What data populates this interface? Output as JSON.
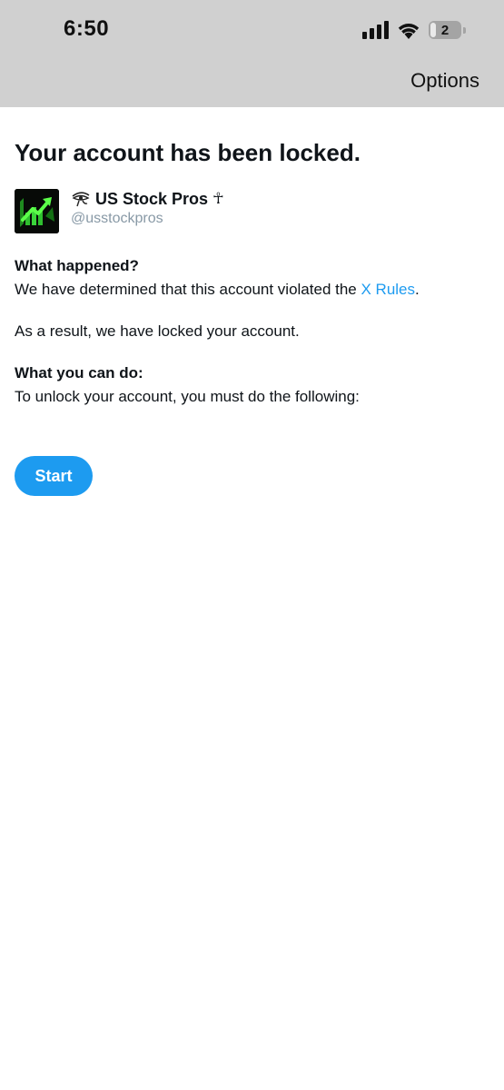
{
  "status_bar": {
    "time": "6:50",
    "battery_level": "2",
    "icons": [
      "cellular-signal-icon",
      "wifi-icon",
      "battery-icon"
    ]
  },
  "header": {
    "options_label": "Options"
  },
  "main": {
    "title": "Your account has been locked.",
    "account": {
      "display_name": "US Stock Pros",
      "name_symbol": "☥",
      "handle": "@usstockpros",
      "avatar_icon": "stock-chart-arrow-icon",
      "badge_icon": "eye-of-horus-icon"
    },
    "what_happened": {
      "heading": "What happened?",
      "text_before_link": "We have determined that this account violated the ",
      "link_text": "X Rules",
      "text_after_link": "."
    },
    "result_text": "As a result, we have locked your account.",
    "what_you_can_do": {
      "heading": "What you can do:",
      "text": "To unlock your account, you must do the following:"
    },
    "start_label": "Start"
  },
  "colors": {
    "accent": "#1d9bf0",
    "header_background": "#d0d0d0",
    "handle_text": "#8899a6"
  }
}
